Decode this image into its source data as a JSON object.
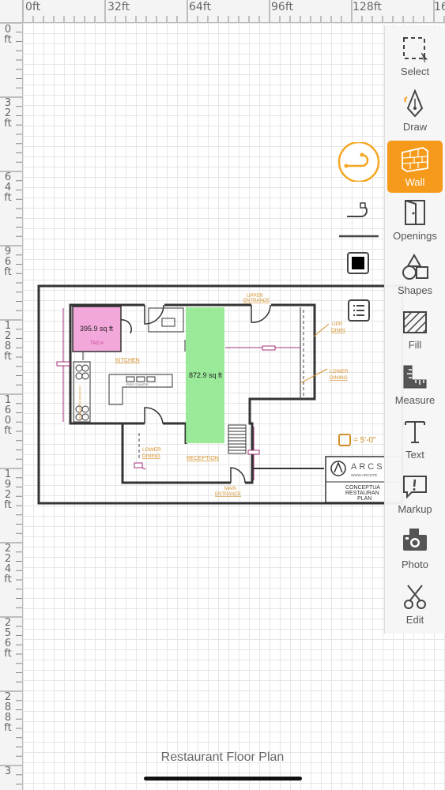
{
  "ruler": {
    "top_labels": [
      "0ft",
      "32ft",
      "64ft",
      "96ft",
      "128ft",
      "16"
    ],
    "left_labels": [
      "0ft",
      "32ft",
      "64ft",
      "96ft",
      "128ft",
      "160ft",
      "192ft",
      "224ft",
      "256ft",
      "288ft",
      "3"
    ]
  },
  "toolbar": {
    "items": [
      {
        "label": "Select",
        "icon": "select-icon"
      },
      {
        "label": "Draw",
        "icon": "pen-icon"
      },
      {
        "label": "Wall",
        "icon": "brick-wall-icon",
        "active": true
      },
      {
        "label": "Openings",
        "icon": "door-icon"
      },
      {
        "label": "Shapes",
        "icon": "shapes-icon"
      },
      {
        "label": "Fill",
        "icon": "hatch-fill-icon"
      },
      {
        "label": "Measure",
        "icon": "ruler-icon"
      },
      {
        "label": "Text",
        "icon": "text-t-icon"
      },
      {
        "label": "Markup",
        "icon": "markup-icon"
      },
      {
        "label": "Photo",
        "icon": "camera-icon"
      },
      {
        "label": "Edit",
        "icon": "scissors-icon"
      }
    ],
    "active_color": "#f59a1b"
  },
  "floating": {
    "curve_icon": "curve-wall-icon",
    "snap_icon": "wall-endpoint-icon",
    "color_swatch": "#000000",
    "list_icon": "list-icon",
    "scale_text": "= 5'-0\""
  },
  "plan": {
    "pink_area": "395.9 sq ft",
    "pink_tag": "TAG #",
    "green_area": "872.9 sq ft",
    "kitchen": "KITCHEN",
    "lower_dining_left": [
      "LOWER",
      "DINING"
    ],
    "reception": "RECEPTION",
    "main_entrance": [
      "MAIN",
      "ENTRANCE"
    ],
    "upper_entrance": [
      "UPPER",
      "ENTRANCE"
    ],
    "upper_dining": [
      "UPP",
      "DININ"
    ],
    "lower_dining_right": [
      "LOWER",
      "DINING"
    ],
    "prep_counter": "PREP COUNTER",
    "equipment": "COOKING EQUIPMENT",
    "title_block_logo": "ARCS",
    "title_block_url": "WWW.ARCSITE",
    "title_block_lines": [
      "CONCEPTUA",
      "RESTAURAN",
      "PLAN"
    ],
    "colors": {
      "pink": "#f3a8dc",
      "green": "#8fe88f",
      "label": "#d4902a",
      "dim": "#a0307a"
    }
  },
  "document_title": "Restaurant Floor Plan"
}
